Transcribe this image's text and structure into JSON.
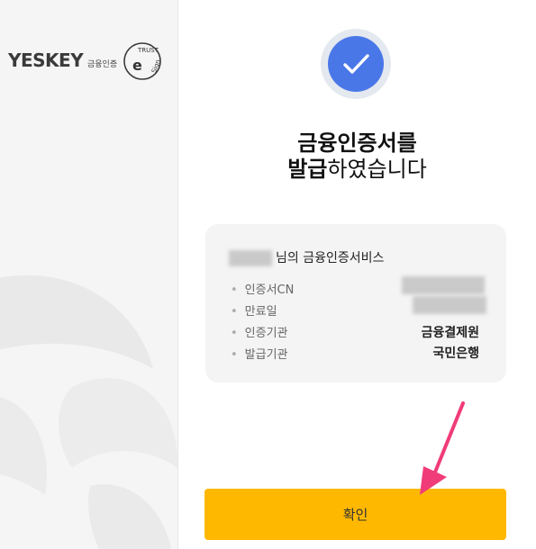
{
  "brand": {
    "name": "YESKEY",
    "name_sub": "금융인증",
    "trust_logo_text": "TRUST e Sign"
  },
  "result": {
    "title_line1": "금융인증서를",
    "title_line2_bold": "발급",
    "title_line2_rest": "하였습니다"
  },
  "certificate": {
    "owner_suffix": "님의 금융인증서비스",
    "fields": [
      {
        "label": "인증서CN",
        "value": ""
      },
      {
        "label": "만료일",
        "value": ""
      },
      {
        "label": "인증기관",
        "value": "금융결제원"
      },
      {
        "label": "발급기관",
        "value": "국민은행"
      }
    ]
  },
  "actions": {
    "confirm_label": "확인"
  },
  "colors": {
    "accent": "#4a77e8",
    "button": "#ffb800",
    "annotation_arrow": "#f03c78"
  },
  "icons": {
    "check": "check-icon",
    "annotation": "arrow-pointer-icon"
  }
}
